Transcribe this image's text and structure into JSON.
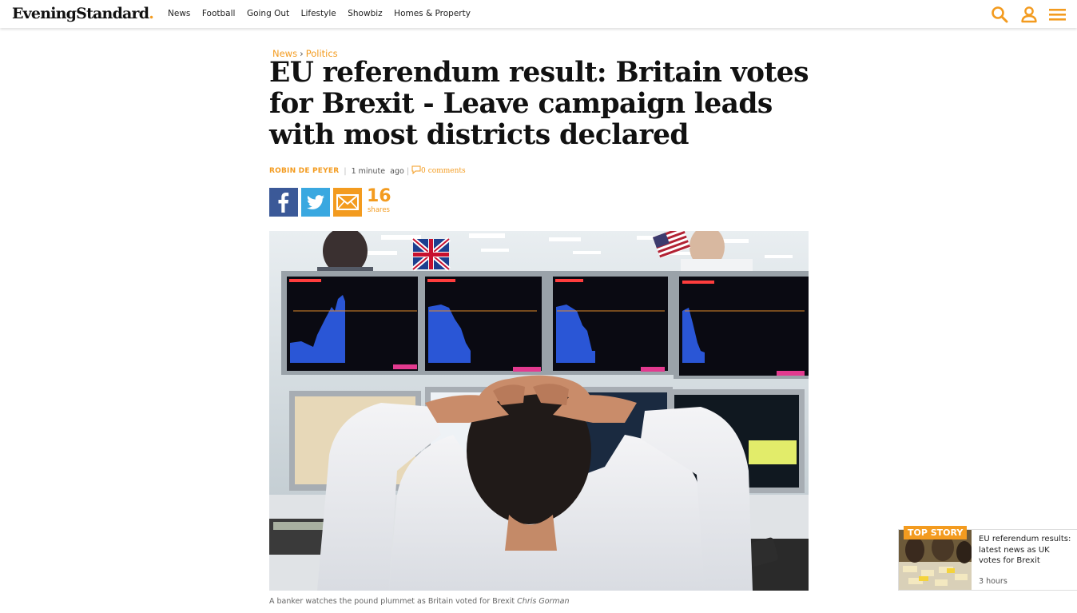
{
  "header": {
    "logo_main": "EveningStandard",
    "logo_dot": ".",
    "nav": [
      "News",
      "Football",
      "Going Out",
      "Lifestyle",
      "Showbiz",
      "Homes & Property"
    ]
  },
  "breadcrumb": {
    "section": "News",
    "separator": "›",
    "subsection": "Politics"
  },
  "article": {
    "headline": "EU referendum result: Britain votes for Brexit - Leave campaign leads with most districts declared",
    "author": "ROBIN DE PEYER",
    "time_value": "1 minute",
    "time_suffix": "ago",
    "comments_count": "0",
    "comments_label": "comments",
    "share_count": "16",
    "share_label": "shares",
    "image_caption": "A banker watches the pound plummet as Britain voted for Brexit",
    "image_credit": "Chris Gorman"
  },
  "top_story": {
    "badge": "TOP STORY",
    "title": "EU referendum results: latest news as UK votes for Brexit",
    "time": "3 hours"
  },
  "colors": {
    "accent": "#f39b1f",
    "facebook": "#3b5998",
    "twitter": "#3aa8e0"
  },
  "icons": [
    "search-icon",
    "user-icon",
    "menu-icon",
    "facebook-icon",
    "twitter-icon",
    "email-icon",
    "comment-icon"
  ]
}
